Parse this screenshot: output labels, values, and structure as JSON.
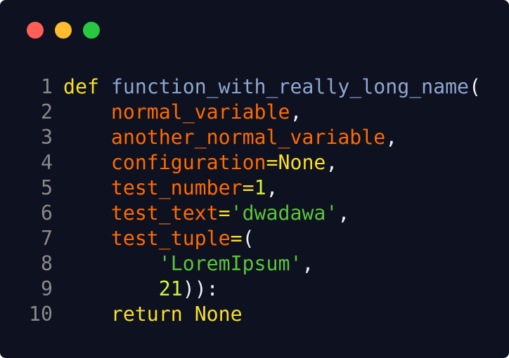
{
  "window": {
    "buttons": [
      {
        "name": "close",
        "color": "#ff5f57"
      },
      {
        "name": "minimize",
        "color": "#febc2e"
      },
      {
        "name": "maximize",
        "color": "#28c840"
      }
    ]
  },
  "code": {
    "lines": [
      {
        "number": "1",
        "tokens": [
          {
            "t": "kw",
            "v": "def"
          },
          {
            "t": "ws",
            "v": " "
          },
          {
            "t": "fn",
            "v": "function_with_really_long_name"
          },
          {
            "t": "punc",
            "v": "("
          }
        ]
      },
      {
        "number": "2",
        "tokens": [
          {
            "t": "ws",
            "v": "    "
          },
          {
            "t": "param",
            "v": "normal_variable"
          },
          {
            "t": "punc",
            "v": ","
          }
        ]
      },
      {
        "number": "3",
        "tokens": [
          {
            "t": "ws",
            "v": "    "
          },
          {
            "t": "param",
            "v": "another_normal_variable"
          },
          {
            "t": "punc",
            "v": ","
          }
        ]
      },
      {
        "number": "4",
        "tokens": [
          {
            "t": "ws",
            "v": "    "
          },
          {
            "t": "param",
            "v": "configuration"
          },
          {
            "t": "op",
            "v": "="
          },
          {
            "t": "kw",
            "v": "None"
          },
          {
            "t": "punc",
            "v": ","
          }
        ]
      },
      {
        "number": "5",
        "tokens": [
          {
            "t": "ws",
            "v": "    "
          },
          {
            "t": "param",
            "v": "test_number"
          },
          {
            "t": "op",
            "v": "="
          },
          {
            "t": "num",
            "v": "1"
          },
          {
            "t": "punc",
            "v": ","
          }
        ]
      },
      {
        "number": "6",
        "tokens": [
          {
            "t": "ws",
            "v": "    "
          },
          {
            "t": "param",
            "v": "test_text"
          },
          {
            "t": "op",
            "v": "="
          },
          {
            "t": "str",
            "v": "'dwadawa'"
          },
          {
            "t": "punc",
            "v": ","
          }
        ]
      },
      {
        "number": "7",
        "tokens": [
          {
            "t": "ws",
            "v": "    "
          },
          {
            "t": "param",
            "v": "test_tuple"
          },
          {
            "t": "op",
            "v": "="
          },
          {
            "t": "punc",
            "v": "("
          }
        ]
      },
      {
        "number": "8",
        "tokens": [
          {
            "t": "ws",
            "v": "        "
          },
          {
            "t": "str",
            "v": "'LoremIpsum'"
          },
          {
            "t": "punc",
            "v": ","
          }
        ]
      },
      {
        "number": "9",
        "tokens": [
          {
            "t": "ws",
            "v": "        "
          },
          {
            "t": "num",
            "v": "21"
          },
          {
            "t": "punc",
            "v": ")):"
          }
        ]
      },
      {
        "number": "10",
        "tokens": [
          {
            "t": "ws",
            "v": "    "
          },
          {
            "t": "kw",
            "v": "return"
          },
          {
            "t": "ws",
            "v": " "
          },
          {
            "t": "kw",
            "v": "None"
          }
        ]
      }
    ]
  }
}
